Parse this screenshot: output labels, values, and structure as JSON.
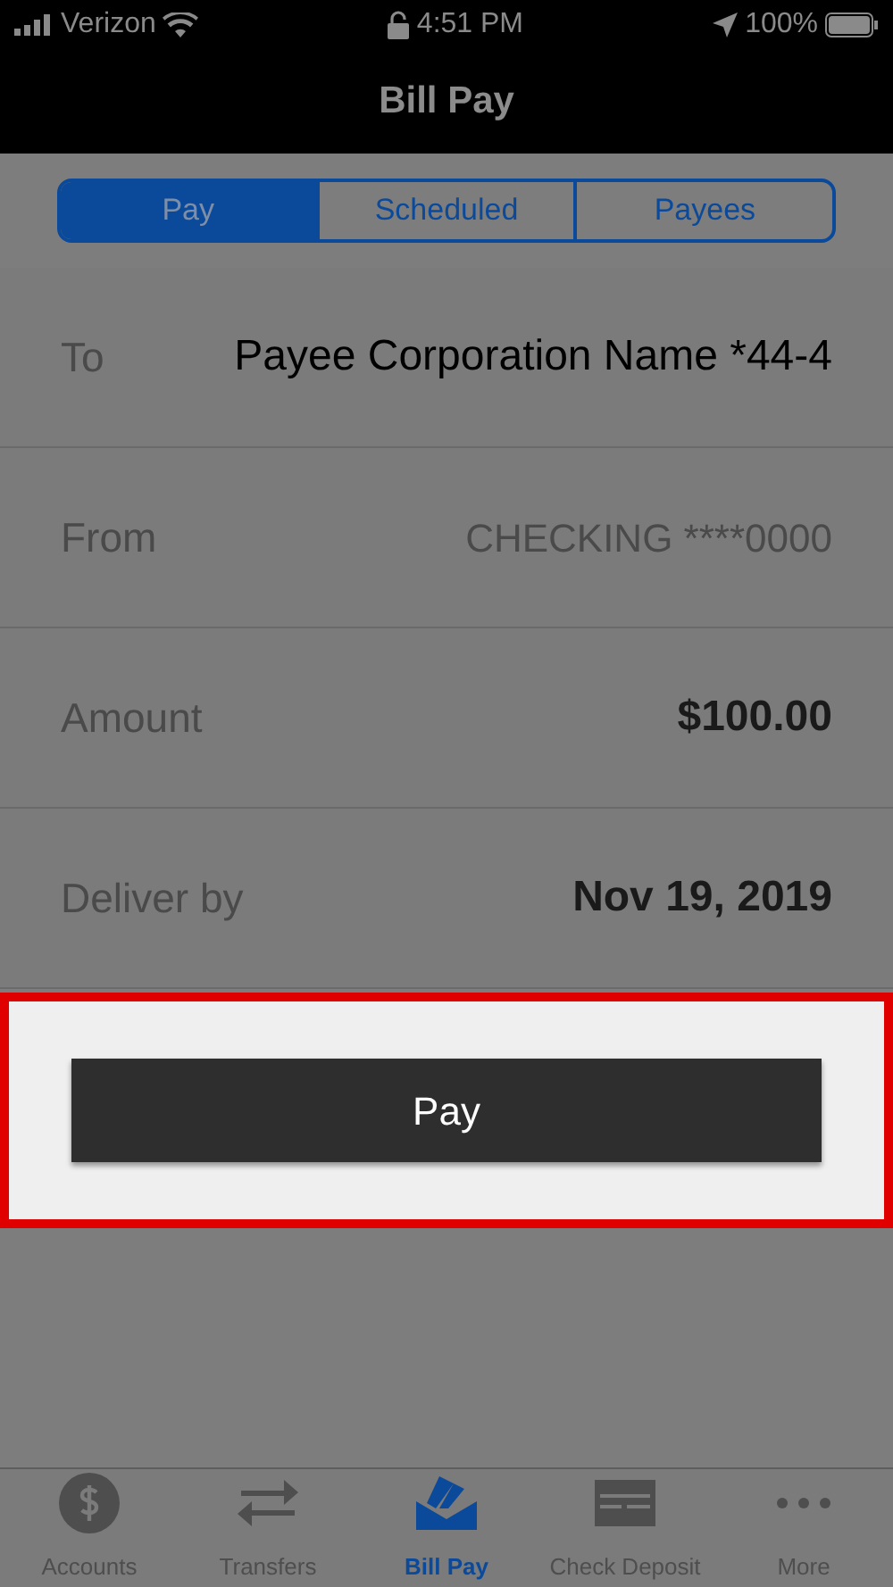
{
  "status_bar": {
    "carrier": "Verizon",
    "time": "4:51 PM",
    "battery": "100%"
  },
  "nav": {
    "title": "Bill Pay"
  },
  "segments": [
    {
      "label": "Pay",
      "selected": true
    },
    {
      "label": "Scheduled",
      "selected": false
    },
    {
      "label": "Payees",
      "selected": false
    }
  ],
  "rows": [
    {
      "label": "To",
      "value": "Payee Corporation Name *44-4",
      "kind": "plain"
    },
    {
      "label": "From",
      "value": "CHECKING ****0000",
      "kind": "muted"
    },
    {
      "label": "Amount",
      "value": "$100.00",
      "kind": "strong"
    },
    {
      "label": "Deliver by",
      "value": "Nov 19, 2019",
      "kind": "strong"
    }
  ],
  "pay_button": "Pay",
  "tab_bar": [
    {
      "label": "Accounts",
      "kind": "dollar",
      "selected": false
    },
    {
      "label": "Transfers",
      "kind": "arrows",
      "selected": false
    },
    {
      "label": "Bill Pay",
      "kind": "envelope",
      "selected": true
    },
    {
      "label": "Check Deposit",
      "kind": "check",
      "selected": false
    },
    {
      "label": "More",
      "kind": "dots",
      "selected": false
    }
  ]
}
